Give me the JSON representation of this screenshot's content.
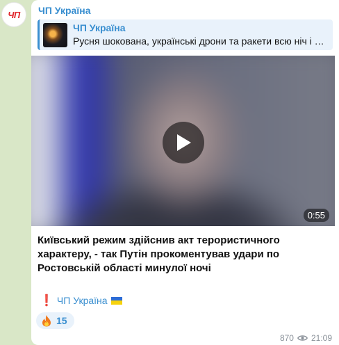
{
  "channel": {
    "avatar_text": "ЧП",
    "name": "ЧП Україна"
  },
  "reply": {
    "title": "ЧП Україна",
    "text": "Русня шокована, українські дрони та ракети всю ніч і …"
  },
  "video": {
    "duration": "0:55"
  },
  "message": {
    "text": "Київський режим здійснив акт терористичного характеру, - так Путін прокоментував удари по Ростовській області минулої ночі",
    "signature_mark": "❗️",
    "signature_link": "ЧП Україна"
  },
  "reaction": {
    "emoji": "fire-emoji",
    "count": "15"
  },
  "meta": {
    "views": "870",
    "time": "21:09"
  },
  "colors": {
    "accent": "#3a8fd0",
    "bubble": "#ffffff",
    "background": "#d9e7c7",
    "brand_red": "#e0262c"
  },
  "icons": [
    "play-icon",
    "eye-icon",
    "fire-icon",
    "ukraine-flag-icon",
    "exclamation-icon"
  ]
}
